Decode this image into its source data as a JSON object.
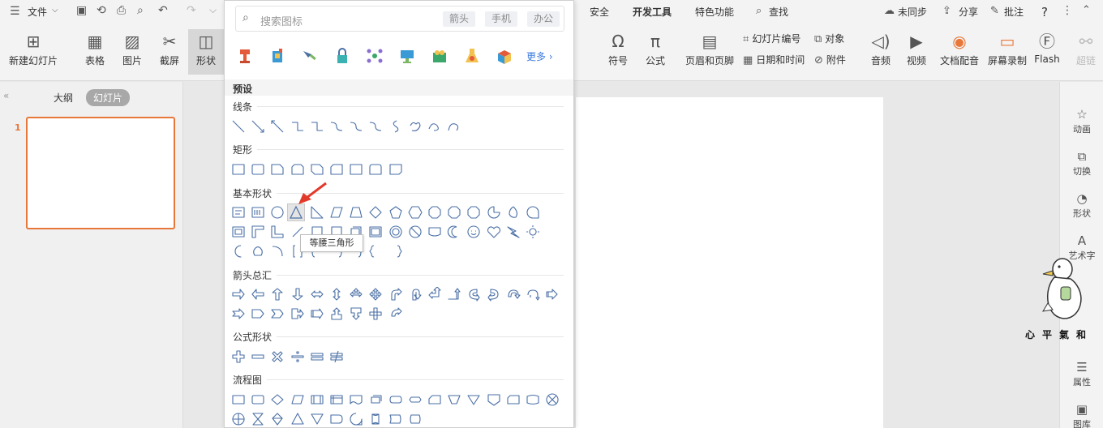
{
  "topbar": {
    "menu_label": "文件",
    "tabs": [
      "安全",
      "开发工具",
      "特色功能"
    ],
    "search_label": "查找",
    "sync_label": "未同步",
    "share_label": "分享",
    "comment_label": "批注",
    "help_glyph": "?"
  },
  "ribbon": {
    "new_slide": "新建幻灯片",
    "table": "表格",
    "picture": "图片",
    "screenshot": "截屏",
    "shape": "形状",
    "symbol": "符号",
    "formula": "公式",
    "header_footer": "页眉和页脚",
    "slide_number": "幻灯片编号",
    "date_time": "日期和时间",
    "object": "对象",
    "attachment": "附件",
    "audio": "音频",
    "video": "视频",
    "doc_voice": "文档配音",
    "screen_record": "屏幕录制",
    "flash": "Flash",
    "hyperlink": "超链"
  },
  "leftpane": {
    "outline_tab": "大纲",
    "slides_tab": "幻灯片",
    "slide_number": "1"
  },
  "rightpane": {
    "items": [
      "动画",
      "切换",
      "形状",
      "艺术字",
      "属性",
      "图库"
    ]
  },
  "watermark": {
    "text": "心平氣和"
  },
  "dropdown": {
    "search_placeholder": "搜索图标",
    "pills": [
      "箭头",
      "手机",
      "办公"
    ],
    "more_label": "更多",
    "preset_label": "预设",
    "categories": {
      "lines": "线条",
      "rectangles": "矩形",
      "basic": "基本形状",
      "arrows": "箭头总汇",
      "equation": "公式形状",
      "flowchart": "流程图"
    },
    "tooltip": "等腰三角形"
  },
  "colors": {
    "accent": "#e8773a",
    "shape_stroke": "#4a6fa5",
    "red_arrow": "#e23a2a"
  }
}
